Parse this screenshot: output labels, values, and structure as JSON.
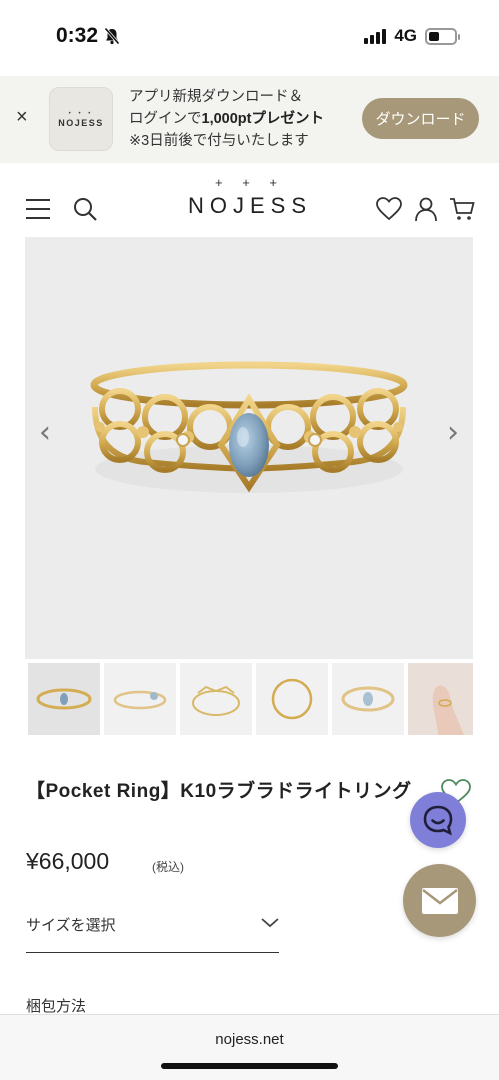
{
  "status": {
    "time": "0:32",
    "network": "4G"
  },
  "banner": {
    "logo_text": "NOJESS",
    "logo_dots": "• • •",
    "line1": "アプリ新規ダウンロード＆",
    "line2_prefix": "ログインで",
    "line2_bold": "1,000ptプレゼント",
    "line3": "※3日前後で付与いたします",
    "button": "ダウンロード",
    "close": "×"
  },
  "header": {
    "logo_plus": "+ + +",
    "logo": "NOJESS"
  },
  "product": {
    "title": "【Pocket Ring】K10ラブラドライトリング",
    "price": "¥66,000",
    "tax": "(税込)",
    "size_label": "サイズを選択",
    "wrap_label": "梱包方法"
  },
  "gallery": {
    "prev": "‹",
    "next": "›",
    "thumb_count": 6
  },
  "browser": {
    "url": "nojess.net"
  },
  "colors": {
    "accent": "#a8987a",
    "chat": "#7f7fd9",
    "gold": "#d4ac52",
    "stone": "#7f9fba"
  }
}
